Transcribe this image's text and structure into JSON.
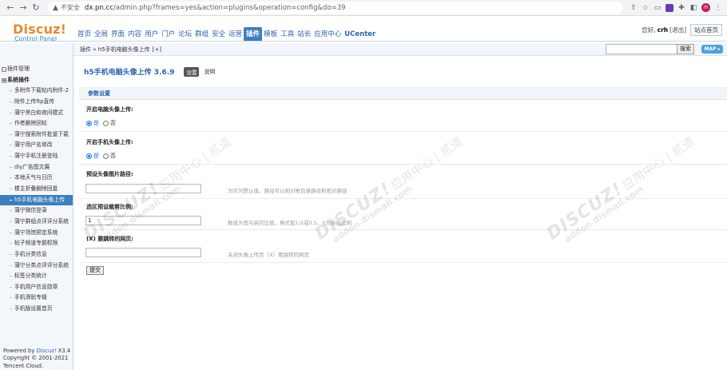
{
  "browser": {
    "insecure_label": "不安全",
    "url_host": "dx.pn.cc",
    "url_path": "/admin.php?frames=yes&action=plugins&operation=config&do=39",
    "avatar_text": "rh"
  },
  "header": {
    "logo_main": "Discuz!",
    "logo_sub": "Control Panel",
    "nav": [
      "首页",
      "全局",
      "界面",
      "内容",
      "用户",
      "门户",
      "论坛",
      "群组",
      "安全",
      "运营",
      "插件",
      "模板",
      "工具",
      "站长",
      "应用中心",
      "UCenter"
    ],
    "nav_active": "插件",
    "greeting": "您好,",
    "username": "crh",
    "logout": "[退出]",
    "site_home": "站点首页"
  },
  "crumb": {
    "path": "插件 » h5手机电脑头像上传",
    "add": "[+]",
    "search_button": "搜索",
    "map_button": "MAP"
  },
  "sidebar": {
    "items": [
      {
        "label": "插件管理",
        "type": "group-plain",
        "box": "□"
      },
      {
        "label": "系统插件",
        "type": "group",
        "box": "⊞"
      },
      {
        "label": "多附件下载帖内附件-2",
        "type": "sub"
      },
      {
        "label": "附件上传ftp直传",
        "type": "sub"
      },
      {
        "label": "蒲宁黑白和夜间模式",
        "type": "sub"
      },
      {
        "label": "作者删除回帖",
        "type": "sub"
      },
      {
        "label": "蒲宁搜索附件批量下载",
        "type": "sub"
      },
      {
        "label": "蒲宁用户名修改",
        "type": "sub"
      },
      {
        "label": "蒲宁手机注册登陆",
        "type": "sub"
      },
      {
        "label": "diy广告图文展",
        "type": "sub"
      },
      {
        "label": "本地天气与日历",
        "type": "sub"
      },
      {
        "label": "楼主折叠删除回复",
        "type": "sub"
      },
      {
        "label": "h5手机电脑头像上传",
        "type": "sub-selected"
      },
      {
        "label": "蒲宁微信登录",
        "type": "sub"
      },
      {
        "label": "蒲宁群组点评评分系统",
        "type": "sub"
      },
      {
        "label": "蒲宁场馆预定系统",
        "type": "sub"
      },
      {
        "label": "帖子频道专题权限",
        "type": "sub"
      },
      {
        "label": "手机分类信息",
        "type": "sub"
      },
      {
        "label": "蒲宁分类点评评分系统",
        "type": "sub"
      },
      {
        "label": "标签分类统计",
        "type": "sub"
      },
      {
        "label": "手机用户信息勋章",
        "type": "sub"
      },
      {
        "label": "手机滑贴专辑",
        "type": "sub"
      },
      {
        "label": "手机版设置首页",
        "type": "sub"
      }
    ],
    "footer_powered": "Powered by",
    "footer_product": "Discuz!",
    "footer_version": "X3.4",
    "footer_copyright": "Copyright © 2001-2021",
    "footer_company": "Tencent Cloud."
  },
  "main": {
    "title": "h5手机电脑头像上传 3.6.9",
    "tab_settings": "设置",
    "tab_description": "说明",
    "section_title": "参数设置",
    "fields": [
      {
        "label": "开启电脑头像上传:",
        "type": "radio",
        "options": [
          "是",
          "否"
        ],
        "selected": "是"
      },
      {
        "label": "开启手机头像上传:",
        "type": "radio",
        "options": [
          "是",
          "否"
        ],
        "selected": "是"
      },
      {
        "label": "预设头像图片路径:",
        "type": "text",
        "value": "",
        "hint": "为空为默认值，路径可以相对根目录路径和绝对路径"
      },
      {
        "label": "选区预设裁剪比例:",
        "type": "text",
        "value": "1",
        "hint": "数值为宽与高的比值，格式如1/2或0.5，0为自由比例"
      },
      {
        "label": "(X) 要跳转的网页:",
        "type": "text",
        "value": "",
        "hint": "关闭头像上传页（X）要跳转的网页"
      }
    ],
    "submit": "提交"
  },
  "watermark": {
    "brand": "DISCUZ!",
    "cn": "应用中心 | 贰道",
    "domain": "addon.dismall.com"
  }
}
